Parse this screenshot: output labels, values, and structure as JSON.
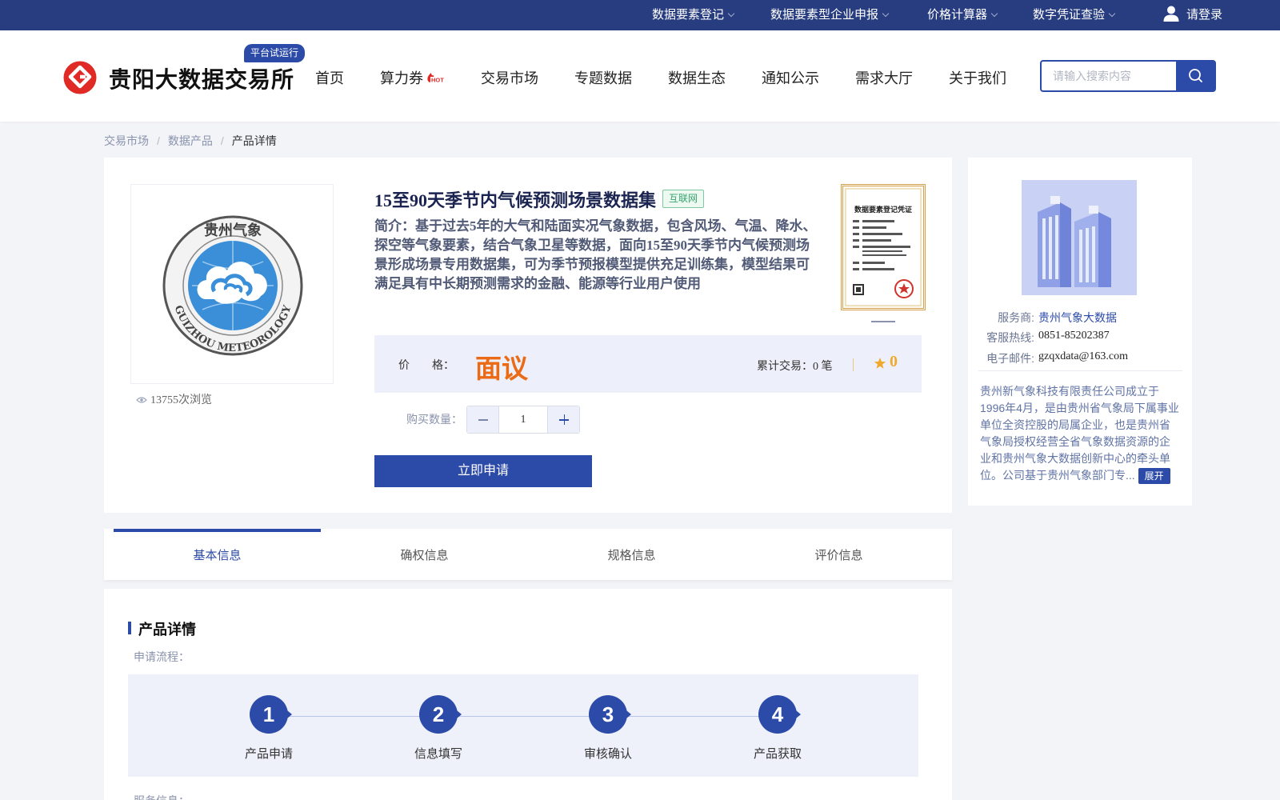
{
  "topbar": {
    "items": [
      "数据要素登记",
      "数据要素型企业申报",
      "价格计算器",
      "数字凭证查验"
    ],
    "login": "请登录"
  },
  "header": {
    "logo_text": "贵阳大数据交易所",
    "trial_badge": "平台试运行",
    "nav": [
      "首页",
      "算力券",
      "交易市场",
      "专题数据",
      "数据生态",
      "通知公示",
      "需求大厅",
      "关于我们"
    ],
    "hot_icon": "hot-flame-icon",
    "search_placeholder": "请输入搜索内容"
  },
  "breadcrumb": [
    "交易市场",
    "数据产品",
    "产品详情"
  ],
  "product": {
    "title": "15至90天季节内气候预测场景数据集",
    "tag": "互联网",
    "intro": "简介：基于过去5年的大气和陆面实况气象数据，包含风场、气温、降水、探空等气象要素，结合气象卫星等数据，面向15至90天季节内气候预测场景形成场景专用数据集，可为季节预报模型提供充足训练集，模型结果可满足具有中长期预测需求的金融、能源等行业用户使用",
    "views": "13755次浏览",
    "logo_text_top": "贵州气象",
    "logo_text_bottom": "GUIZHOU METEOROLOGY",
    "cert_title": "数据要素登记凭证",
    "price_label": "价　　格：",
    "price_value": "面议",
    "traded": "累计交易：0 笔",
    "rating": "0",
    "qty_label": "购买数量：",
    "qty_value": "1",
    "apply_label": "立即申请"
  },
  "provider": {
    "service_label": "服务商:",
    "service_value": "贵州气象大数据",
    "hotline_label": "客服热线:",
    "hotline_value": "0851-85202387",
    "email_label": "电子邮件:",
    "email_value": "gzqxdata@163.com",
    "description": "贵州新气象科技有限责任公司成立于1996年4月，是由贵州省气象局下属事业单位全资控股的局属企业，也是贵州省气象局授权经营全省气象数据资源的企业和贵州气象大数据创新中心的牵头单位。公司基于贵州气象部门专...",
    "expand_label": "展开"
  },
  "tabs": [
    "基本信息",
    "确权信息",
    "规格信息",
    "评价信息"
  ],
  "detail": {
    "section_title": "产品详情",
    "flow_label": "申请流程：",
    "steps": [
      {
        "num": "1",
        "label": "产品申请"
      },
      {
        "num": "2",
        "label": "信息填写"
      },
      {
        "num": "3",
        "label": "审核确认"
      },
      {
        "num": "4",
        "label": "产品获取"
      }
    ],
    "service_info_label": "服务信息："
  },
  "colors": {
    "brand": "#2c4ba8",
    "topbar": "#283d80",
    "price": "#ea6a15",
    "tag_green": "#35a46d",
    "star": "#f0a92b"
  }
}
